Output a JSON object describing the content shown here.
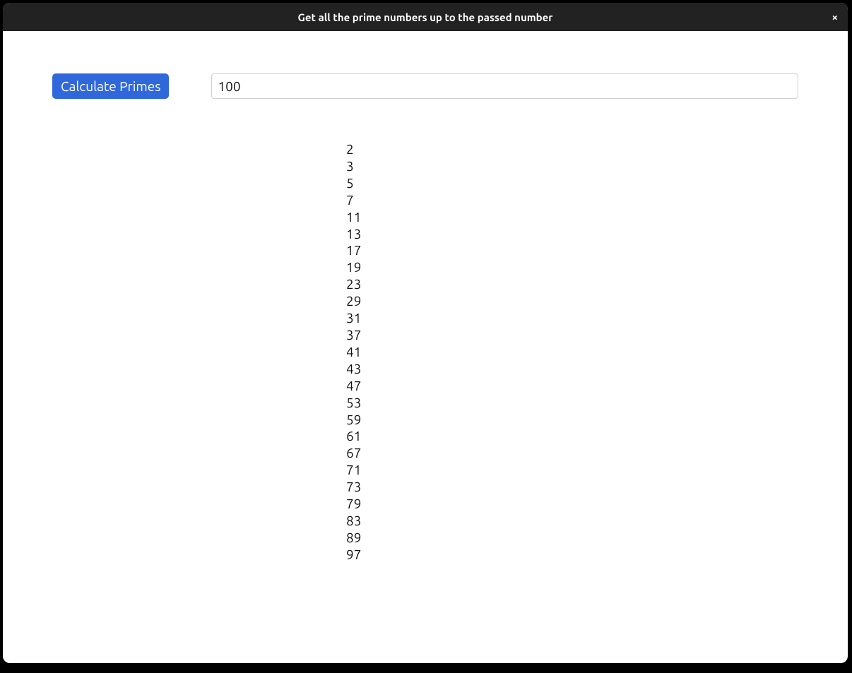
{
  "window": {
    "title": "Get all the prime numbers up to the passed number",
    "close_icon": "×"
  },
  "controls": {
    "button_label": "Calculate Primes",
    "input_value": "100"
  },
  "results": {
    "primes": [
      "2",
      "3",
      "5",
      "7",
      "11",
      "13",
      "17",
      "19",
      "23",
      "29",
      "31",
      "37",
      "41",
      "43",
      "47",
      "53",
      "59",
      "61",
      "67",
      "71",
      "73",
      "79",
      "83",
      "89",
      "97"
    ]
  }
}
